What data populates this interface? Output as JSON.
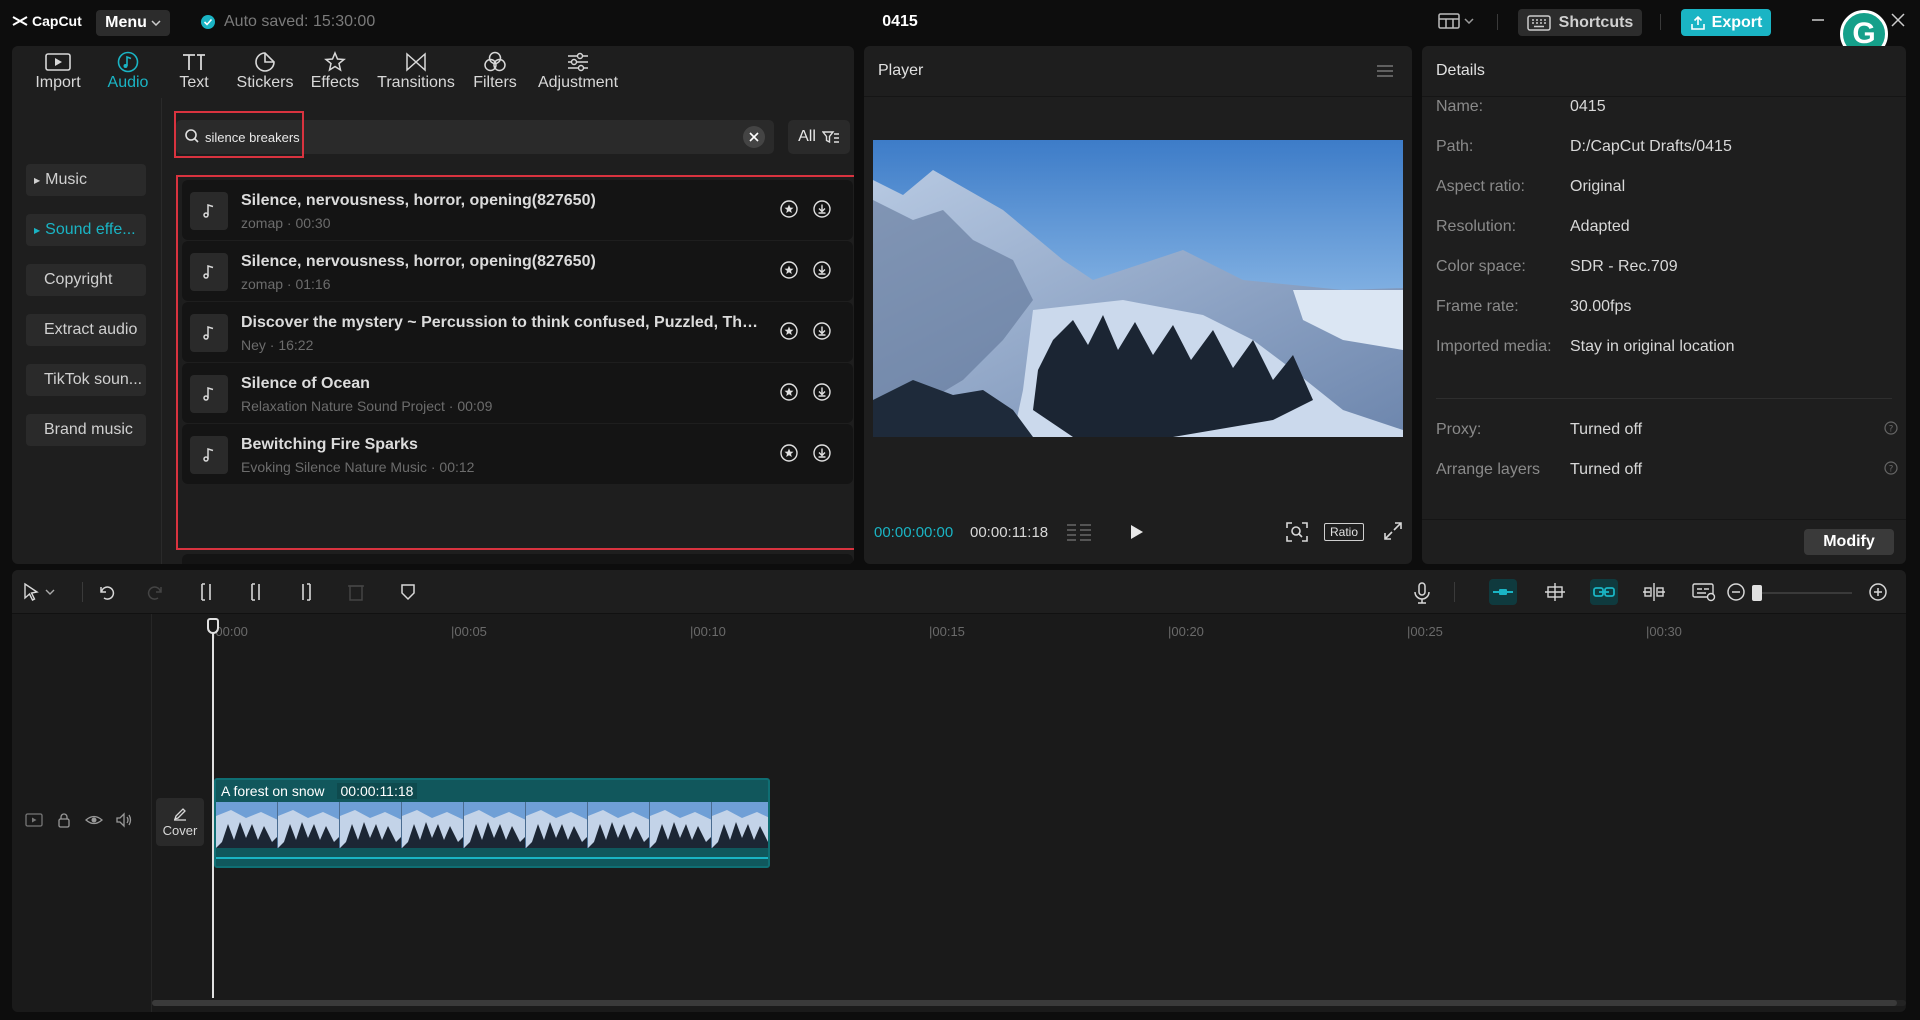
{
  "app": {
    "logo_text": "CapCut",
    "menu_label": "Menu",
    "autosave": "Auto saved: 15:30:00",
    "project_title": "0415",
    "shortcuts_label": "Shortcuts",
    "export_label": "Export"
  },
  "tool_tabs": [
    {
      "label": "Import",
      "icon": "import-icon"
    },
    {
      "label": "Audio",
      "icon": "audio-icon",
      "active": true
    },
    {
      "label": "Text",
      "icon": "text-icon"
    },
    {
      "label": "Stickers",
      "icon": "stickers-icon"
    },
    {
      "label": "Effects",
      "icon": "effects-icon"
    },
    {
      "label": "Transitions",
      "icon": "transitions-icon"
    },
    {
      "label": "Filters",
      "icon": "filters-icon"
    },
    {
      "label": "Adjustment",
      "icon": "adjustment-icon"
    }
  ],
  "categories": [
    {
      "label": "Music"
    },
    {
      "label": "Sound effe..."
    },
    {
      "label": "Copyright"
    },
    {
      "label": "Extract audio"
    },
    {
      "label": "TikTok soun..."
    },
    {
      "label": "Brand music"
    }
  ],
  "search": {
    "value": "silence breakers",
    "filter_label": "All"
  },
  "results": [
    {
      "title": "Silence, nervousness, horror, opening(827650)",
      "subtitle": "zomap · 00:30"
    },
    {
      "title": "Silence, nervousness, horror, opening(827650)",
      "subtitle": "zomap · 01:16"
    },
    {
      "title": "Discover the mystery ~ Percussion to think confused, Puzzled, Thinking, Silence",
      "subtitle": "Ney · 16:22"
    },
    {
      "title": "Silence of Ocean",
      "subtitle": "Relaxation Nature Sound Project · 00:09"
    },
    {
      "title": "Bewitching Fire Sparks",
      "subtitle": "Evoking Silence Nature Music · 00:12"
    }
  ],
  "player": {
    "title": "Player",
    "time_current": "00:00:00:00",
    "time_total": "00:00:11:18",
    "ratio_label": "Ratio"
  },
  "details": {
    "title": "Details",
    "rows": [
      {
        "label": "Name:",
        "value": "0415"
      },
      {
        "label": "Path:",
        "value": "D:/CapCut Drafts/0415"
      },
      {
        "label": "Aspect ratio:",
        "value": "Original"
      },
      {
        "label": "Resolution:",
        "value": "Adapted"
      },
      {
        "label": "Color space:",
        "value": "SDR - Rec.709"
      },
      {
        "label": "Frame rate:",
        "value": "30.00fps"
      },
      {
        "label": "Imported media:",
        "value": "Stay in original location"
      }
    ],
    "extra_rows": [
      {
        "label": "Proxy:",
        "value": "Turned off"
      },
      {
        "label": "Arrange layers",
        "value": "Turned off"
      }
    ],
    "modify_label": "Modify"
  },
  "timeline": {
    "ruler": [
      "|00:00",
      "|00:05",
      "|00:10",
      "|00:15",
      "|00:20",
      "|00:25",
      "|00:30"
    ],
    "cover_label": "Cover",
    "clip": {
      "name": "A forest on snow",
      "duration": "00:00:11:18"
    }
  },
  "colors": {
    "accent": "#1ab4c4",
    "highlight": "#d9333f",
    "clip": "#0f6e73"
  }
}
